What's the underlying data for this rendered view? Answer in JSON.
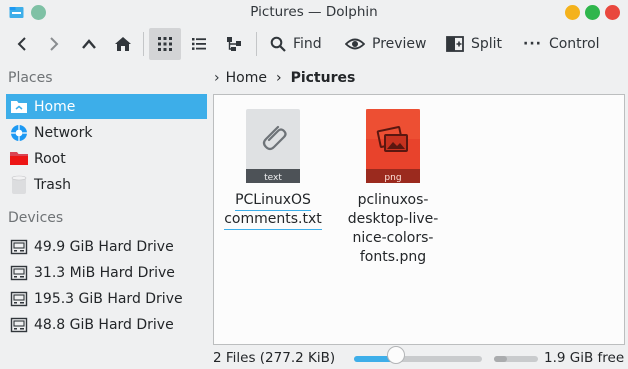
{
  "window": {
    "title": "Pictures — Dolphin"
  },
  "toolbar": {
    "find_label": "Find",
    "preview_label": "Preview",
    "split_label": "Split",
    "control_label": "Control"
  },
  "sidebar": {
    "places_heading": "Places",
    "places": [
      {
        "label": "Home",
        "icon": "home-folder-icon",
        "selected": true
      },
      {
        "label": "Network",
        "icon": "network-icon"
      },
      {
        "label": "Root",
        "icon": "root-folder-icon"
      },
      {
        "label": "Trash",
        "icon": "trash-icon"
      }
    ],
    "devices_heading": "Devices",
    "devices": [
      {
        "label": "49.9 GiB Hard Drive",
        "icon": "hard-drive-icon"
      },
      {
        "label": "31.3 MiB Hard Drive",
        "icon": "hard-drive-icon"
      },
      {
        "label": "195.3 GiB Hard Drive",
        "icon": "hard-drive-icon"
      },
      {
        "label": "48.8 GiB Hard Drive",
        "icon": "hard-drive-icon"
      }
    ]
  },
  "breadcrumb": {
    "items": [
      "Home",
      "Pictures"
    ]
  },
  "files": [
    {
      "name_lines": [
        "PCLinuxOS",
        "comments.txt"
      ],
      "type_badge": "text",
      "icon": "text-file-icon",
      "selected": true
    },
    {
      "name_lines": [
        "pclinuxos-",
        "desktop-live-",
        "nice-colors-",
        "fonts.png"
      ],
      "type_badge": "png",
      "icon": "png-image-icon",
      "selected": false
    }
  ],
  "status": {
    "count": "2 Files (277.2 KiB)",
    "free": "1.9 GiB free",
    "zoom_fraction": 0.33,
    "used_fraction": 0.3
  },
  "colors": {
    "accent": "#3daee9",
    "window_bg": "#eff0f1",
    "view_bg": "#fcfcfc",
    "png_icon": "#e8432c",
    "minimize": "#f4b21c",
    "maximize": "#2fb64c",
    "close": "#e9483e"
  }
}
